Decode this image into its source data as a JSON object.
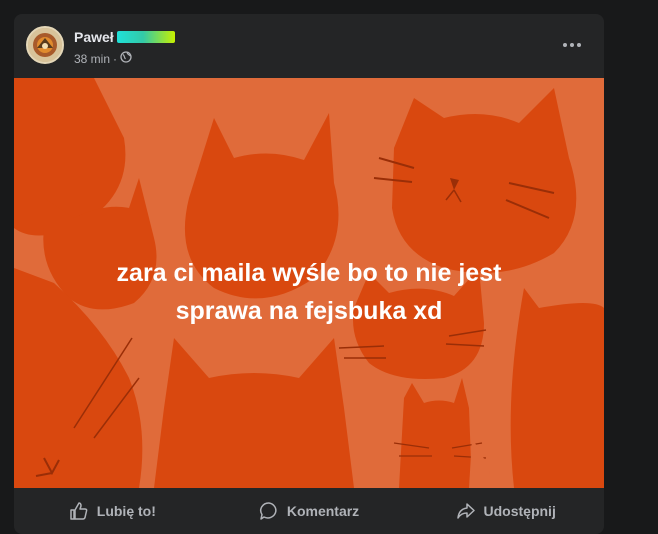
{
  "post": {
    "author_name": "Paweł",
    "time": "38 min",
    "privacy_icon": "globe-icon",
    "more_icon": "more-horizontal-icon",
    "image": {
      "background_color": "#e06b3a",
      "cat_color": "#d9480f",
      "text_line1": "zara ci maila wyśle bo to nie jest",
      "text_line2": "sprawa na fejsbuka xd"
    }
  },
  "actions": {
    "like_label": "Lubię to!",
    "comment_label": "Komentarz",
    "share_label": "Udostępnij"
  }
}
